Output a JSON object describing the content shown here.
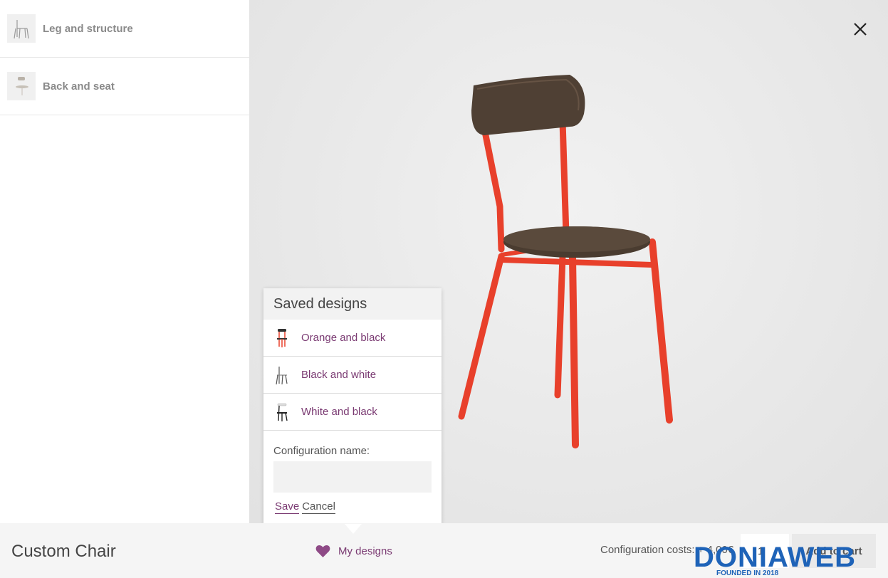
{
  "sidebar": {
    "items": [
      {
        "label": "Leg and structure",
        "icon": "chair-frame-icon"
      },
      {
        "label": "Back and seat",
        "icon": "chair-seat-icon"
      }
    ]
  },
  "popup": {
    "title": "Saved designs",
    "designs": [
      {
        "label": "Orange and black",
        "icon": "chair-orange-black-icon"
      },
      {
        "label": "Black and white",
        "icon": "chair-black-white-icon"
      },
      {
        "label": "White and black",
        "icon": "chair-white-black-icon"
      }
    ],
    "config_label": "Configuration name:",
    "config_value": "",
    "save_label": "Save",
    "cancel_label": "Cancel"
  },
  "bottom": {
    "product_title": "Custom Chair",
    "my_designs_label": "My designs",
    "costs_label": "Configuration costs: + 4,00€",
    "quantity": "1",
    "add_to_cart_label": "Add to cart"
  },
  "watermark": {
    "brand": "DONIAWEB",
    "tagline": "FOUNDED IN 2018"
  },
  "colors": {
    "accent": "#7a3a72",
    "chair_frame": "#e8402b",
    "wood": "#4a3c30"
  }
}
